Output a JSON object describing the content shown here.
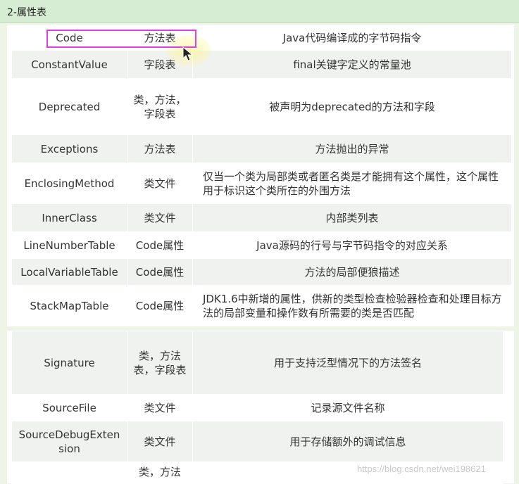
{
  "header": {
    "title": "2-属性表"
  },
  "table1": [
    {
      "name": "Code",
      "scope": "方法表",
      "desc": "Java代码编译成的字节码指令"
    },
    {
      "name": "ConstantValue",
      "scope": "字段表",
      "desc": "final关键字定义的常量池"
    },
    {
      "name": "Deprecated",
      "scope": "类，方法，字段表",
      "desc": "被声明为deprecated的方法和字段"
    },
    {
      "name": "Exceptions",
      "scope": "方法表",
      "desc": "方法抛出的异常"
    },
    {
      "name": "EnclosingMethod",
      "scope": "类文件",
      "desc": "仅当一个类为局部类或者匿名类是才能拥有这个属性，这个属性用于标识这个类所在的外围方法"
    },
    {
      "name": "InnerClass",
      "scope": "类文件",
      "desc": "内部类列表"
    },
    {
      "name": "LineNumberTable",
      "scope": "Code属性",
      "desc": "Java源码的行号与字节码指令的对应关系"
    },
    {
      "name": "LocalVariableTable",
      "scope": "Code属性",
      "desc": "方法的局部便狼描述"
    },
    {
      "name": "StackMapTable",
      "scope": "Code属性",
      "desc": "JDK1.6中新增的属性，供新的类型检查检验器检查和处理目标方法的局部变量和操作数有所需要的类是否匹配"
    }
  ],
  "table2": [
    {
      "name": "Signature",
      "scope": "类，方法表，字段表",
      "desc": "用于支持泛型情况下的方法签名"
    },
    {
      "name": "SourceFile",
      "scope": "类文件",
      "desc": "记录源文件名称"
    },
    {
      "name": "SourceDebugExtension",
      "scope": "类文件",
      "desc": "用于存储额外的调试信息"
    },
    {
      "name": "",
      "scope": "类，方法",
      "desc": ""
    }
  ],
  "watermark": "https://blog.csdn.net/wei198621",
  "colors": {
    "header_bg": "#d6ecd3",
    "highlight": "#e040e0",
    "row_shade": "#f0f2f0"
  }
}
